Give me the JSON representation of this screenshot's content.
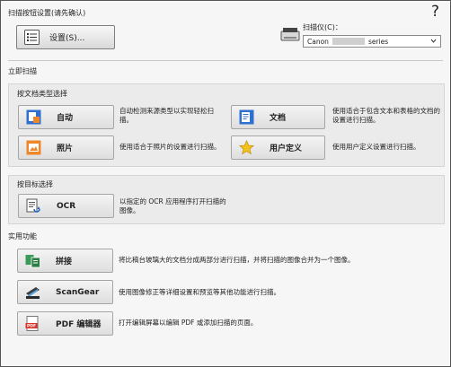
{
  "scan_settings": {
    "section_title": "扫描按钮设置(请先确认)",
    "settings_button": "设置(S)...",
    "help_icon": "?",
    "scanner_label": "扫描仪(C)：",
    "scanner_value_prefix": "Canon",
    "scanner_value_suffix": "series"
  },
  "quick_scan": {
    "section_title": "立即扫描",
    "by_doc_type": {
      "title": "按文档类型选择",
      "items": [
        {
          "label": "自动",
          "desc": "自动检测来源类型以实现轻松扫描。",
          "icon": "auto-scan-icon"
        },
        {
          "label": "文档",
          "desc": "使用适合于包含文本和表格的文档的设置进行扫描。",
          "icon": "document-icon"
        },
        {
          "label": "照片",
          "desc": "使用适合于照片的设置进行扫描。",
          "icon": "photo-icon"
        },
        {
          "label": "用户定义",
          "desc": "使用用户定义设置进行扫描。",
          "icon": "star-icon"
        }
      ]
    },
    "by_destination": {
      "title": "按目标选择",
      "items": [
        {
          "label": "OCR",
          "desc": "以指定的 OCR 应用程序打开扫描的图像。",
          "icon": "ocr-icon"
        }
      ]
    }
  },
  "utilities": {
    "section_title": "实用功能",
    "items": [
      {
        "label": "拼接",
        "desc": "将比稿台玻璃大的文档分成两部分进行扫描，并将扫描的图像合并为一个图像。",
        "icon": "stitch-icon"
      },
      {
        "label": "ScanGear",
        "desc": "使用图像修正等详细设置和预览等其他功能进行扫描。",
        "icon": "scangear-icon"
      },
      {
        "label": "PDF 编辑器",
        "desc": "打开编辑屏幕以编辑 PDF 或添加扫描的页面。",
        "icon": "pdf-editor-icon"
      }
    ]
  },
  "colors": {
    "accent_blue": "#1f63c6",
    "pdf_red": "#d9302a",
    "star_yellow": "#f2c21b",
    "photo_orange": "#f0862a",
    "stitch_green": "#3a9a58"
  }
}
